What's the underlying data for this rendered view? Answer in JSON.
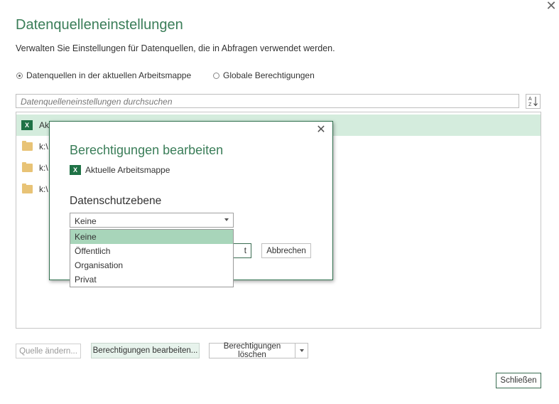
{
  "dialog": {
    "close_glyph": "✕",
    "title": "Datenquelleneinstellungen",
    "description": "Verwalten Sie Einstellungen für Datenquellen, die in Abfragen verwendet werden.",
    "radio_current": "Datenquellen in der aktuellen Arbeitsmappe",
    "radio_global": "Globale Berechtigungen",
    "selected_scope": "current",
    "search_placeholder": "Datenquelleneinstellungen durchsuchen",
    "sort_icon": "sort-az-icon",
    "sources": [
      {
        "icon": "excel-icon",
        "label": "Ak",
        "selected": true
      },
      {
        "icon": "folder-icon",
        "label": "k:\\",
        "selected": false
      },
      {
        "icon": "folder-icon",
        "label": "k:\\",
        "selected": false
      },
      {
        "icon": "folder-icon",
        "label": "k:\\",
        "selected": false
      }
    ],
    "buttons": {
      "change_source": "Quelle ändern...",
      "edit_permissions": "Berechtigungen bearbeiten...",
      "clear_permissions": "Berechtigungen löschen",
      "close": "Schließen"
    }
  },
  "modal": {
    "title": "Berechtigungen bearbeiten",
    "close_glyph": "✕",
    "source_label": "Aktuelle Arbeitsmappe",
    "privacy_label": "Datenschutzebene",
    "selected_level": "Keine",
    "options": [
      "Keine",
      "Öffentlich",
      "Organisation",
      "Privat"
    ],
    "ok_partial": "t",
    "cancel": "Abbrechen"
  },
  "colors": {
    "accent": "#3a7d58",
    "excel_green": "#1f7246",
    "selection_bg": "#d4ecdd",
    "option_highlight": "#a8d5ba"
  }
}
